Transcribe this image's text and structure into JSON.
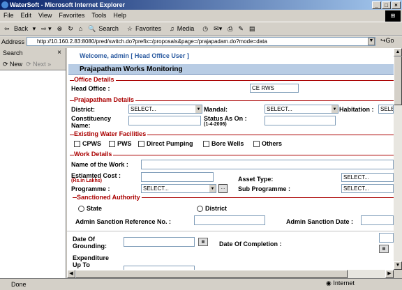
{
  "window": {
    "title": "WaterSoft - Microsoft Internet Explorer"
  },
  "menu": [
    "File",
    "Edit",
    "View",
    "Favorites",
    "Tools",
    "Help"
  ],
  "toolbar": {
    "back": "Back",
    "search": "Search",
    "favorites": "Favorites",
    "media": "Media"
  },
  "address": {
    "label": "Address",
    "url": "http://10.160.2.83:8080/pred/switch.do?prefix=/proposals&page=/prajapadam.do?mode=data",
    "go": "Go"
  },
  "sidebar": {
    "title": "Search",
    "new": "New",
    "next": "Next"
  },
  "page": {
    "welcome": "Welcome, admin [ Head Office User ]",
    "heading": "Prajapatham Works Monitoring",
    "office_details": "Office Details",
    "head_office_label": "Head Office :",
    "head_office_value": "CE RWS",
    "praja_details": "Prajapatham Details",
    "district_label": "District:",
    "district_value": "SELECT...",
    "mandal_label": "Mandal:",
    "mandal_value": "SELECT...",
    "habitation_label": "Habitation :",
    "habitation_value": "SELE",
    "constituency_label_1": "Constituency",
    "constituency_label_2": "Name:",
    "status_label": "Status As On :",
    "status_date": "(1-4-2006)",
    "water_fac": "Existing Water Facilities",
    "facilities": [
      "CPWS",
      "PWS",
      "Direct Pumping",
      "Bore Wells",
      "Others"
    ],
    "work_details": "Work Details",
    "work_name_label": "Name of the Work :",
    "est_cost_label": "Estiamted Cost :",
    "est_cost_unit": "(Rs.in Lakhs)",
    "asset_type_label": "Asset Type:",
    "asset_type_value": "SELECT...",
    "programme_label": "Programme :",
    "programme_value": "SELECT...",
    "sub_programme_label": "Sub Programme :",
    "sub_programme_value": "SELECT...",
    "dots": "...",
    "sanctioned": "Sanctioned Authority",
    "state": "State",
    "district": "District",
    "admin_ref_label": "Admin Sanction Reference No. :",
    "admin_date_label": "Admin Sanction Date :",
    "grounding_label_1": "Date Of",
    "grounding_label_2": "Grounding:",
    "completion_label": "Date Of Completion :",
    "expenditure_label_1": "Expenditure",
    "expenditure_label_2": "Up To"
  },
  "status": {
    "done": "Done",
    "zone": "Internet"
  }
}
